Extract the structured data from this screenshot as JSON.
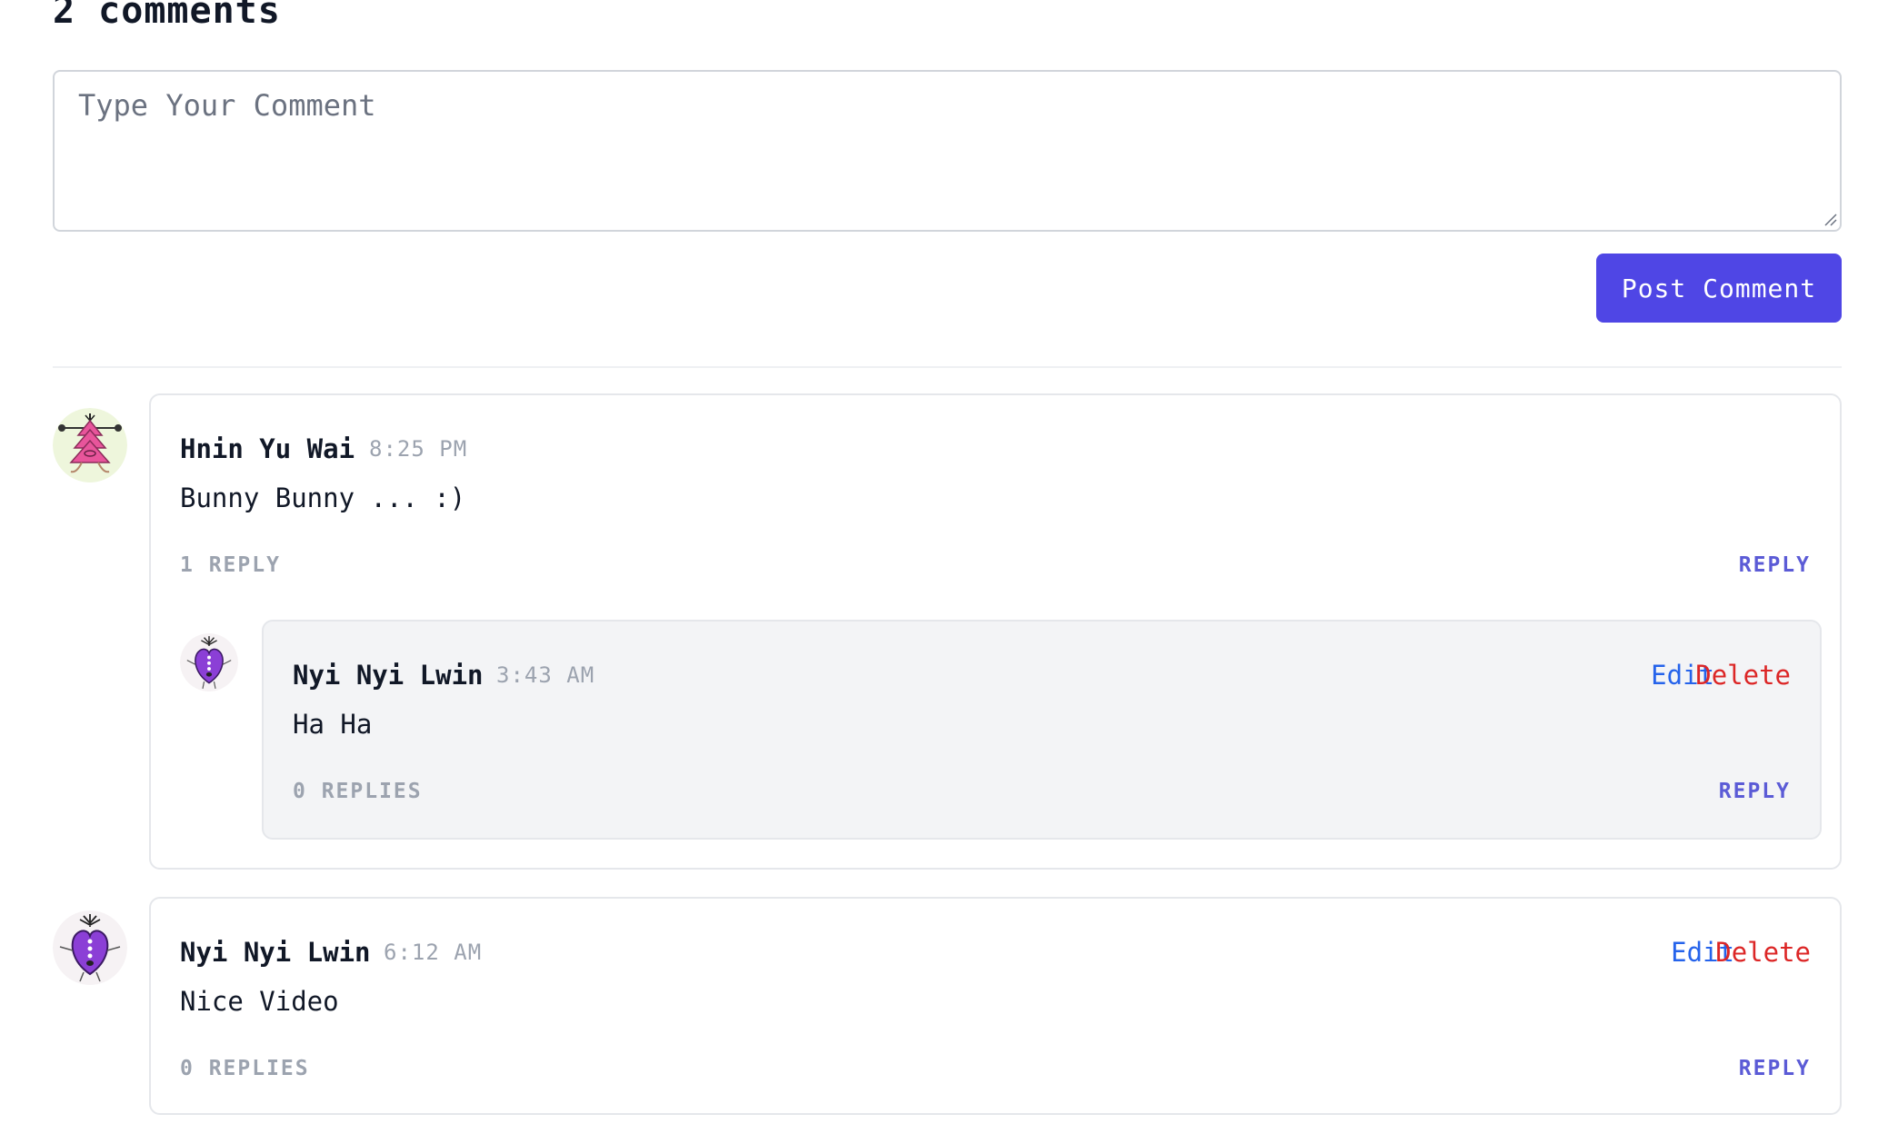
{
  "comments_section": {
    "title": "2 comments",
    "input_placeholder": "Type Your Comment",
    "post_button_label": "Post Comment"
  },
  "comments": [
    {
      "author": "Hnin Yu Wai",
      "time": "8:25 PM",
      "text": "Bunny Bunny ... :)",
      "reply_count_label": "1 REPLY",
      "reply_label": "REPLY",
      "avatar_icon": "pink-tree-creature-icon",
      "replies": [
        {
          "author": "Nyi Nyi Lwin",
          "time": "3:43 AM",
          "text": "Ha Ha",
          "reply_count_label": "0 REPLIES",
          "reply_label": "REPLY",
          "edit_label": "Edit",
          "delete_label": "Delete",
          "avatar_icon": "purple-heart-creature-icon"
        }
      ]
    },
    {
      "author": "Nyi Nyi Lwin",
      "time": "6:12 AM",
      "text": "Nice Video",
      "reply_count_label": "0 REPLIES",
      "reply_label": "REPLY",
      "edit_label": "Edit",
      "delete_label": "Delete",
      "avatar_icon": "purple-heart-creature-icon"
    }
  ],
  "colors": {
    "accent": "#4f46e5",
    "reply_link": "#5b5bd6",
    "edit": "#2563eb",
    "delete": "#dc2626",
    "muted": "#9ca3af",
    "reply_card_bg": "#f3f4f6"
  }
}
